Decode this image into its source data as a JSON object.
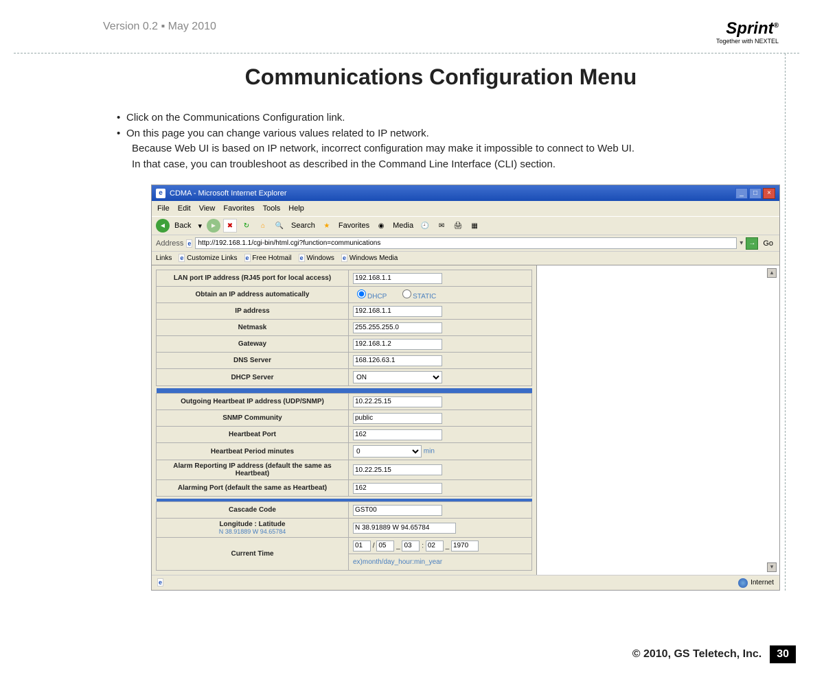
{
  "header": {
    "version": "Version 0.2 ▪ May 2010",
    "logo": "Sprint",
    "logo_tag": "Together with NEXTEL"
  },
  "title": "Communications Configuration Menu",
  "bullets": {
    "b1": "Click on the Communications Configuration link.",
    "b2": "On this page you can change various values related to IP network.",
    "b2a": "Because Web UI is based on IP network, incorrect configuration may make it impossible to connect to Web UI.",
    "b2b": "In that case, you can troubleshoot as described in the Command Line Interface (CLI) section."
  },
  "ie": {
    "title": "CDMA - Microsoft Internet Explorer",
    "menus": [
      "File",
      "Edit",
      "View",
      "Favorites",
      "Tools",
      "Help"
    ],
    "toolbar": {
      "back": "Back",
      "search": "Search",
      "favorites": "Favorites",
      "media": "Media"
    },
    "address_label": "Address",
    "address": "http://192.168.1.1/cgi-bin/html.cgi?function=communications",
    "go": "Go",
    "links_label": "Links",
    "links": [
      "Customize Links",
      "Free Hotmail",
      "Windows",
      "Windows Media"
    ],
    "status_zone": "Internet"
  },
  "form": {
    "lan_label": "LAN port IP address (RJ45 port for local access)",
    "lan_value": "192.168.1.1",
    "obtain_label": "Obtain an IP address automatically",
    "obtain_opt1": "DHCP",
    "obtain_opt2": "STATIC",
    "ip_label": "IP address",
    "ip_value": "192.168.1.1",
    "netmask_label": "Netmask",
    "netmask_value": "255.255.255.0",
    "gateway_label": "Gateway",
    "gateway_value": "192.168.1.2",
    "dns_label": "DNS Server",
    "dns_value": "168.126.63.1",
    "dhcp_label": "DHCP Server",
    "dhcp_value": "ON",
    "out_hb_label": "Outgoing Heartbeat IP address (UDP/SNMP)",
    "out_hb_value": "10.22.25.15",
    "snmp_label": "SNMP Community",
    "snmp_value": "public",
    "hb_port_label": "Heartbeat Port",
    "hb_port_value": "162",
    "hb_period_label": "Heartbeat Period minutes",
    "hb_period_value": "0",
    "hb_period_unit": "min",
    "alarm_ip_label": "Alarm Reporting IP address (default the same as Heartbeat)",
    "alarm_ip_value": "10.22.25.15",
    "alarm_port_label": "Alarming Port (default the same as Heartbeat)",
    "alarm_port_value": "162",
    "cascade_label": "Cascade Code",
    "cascade_value": "GST00",
    "lonlat_label": "Longitude : Latitude",
    "lonlat_sub": "N 38.91889 W 94.65784",
    "lonlat_value": "N 38.91889 W 94.65784",
    "time_label": "Current Time",
    "time_month": "01",
    "time_day": "05",
    "time_hour": "03",
    "time_min": "02",
    "time_year": "1970",
    "time_hint": "ex)month/day_hour:min_year"
  },
  "footer": {
    "copyright": "© 2010, GS Teletech, Inc.",
    "page": "30"
  }
}
